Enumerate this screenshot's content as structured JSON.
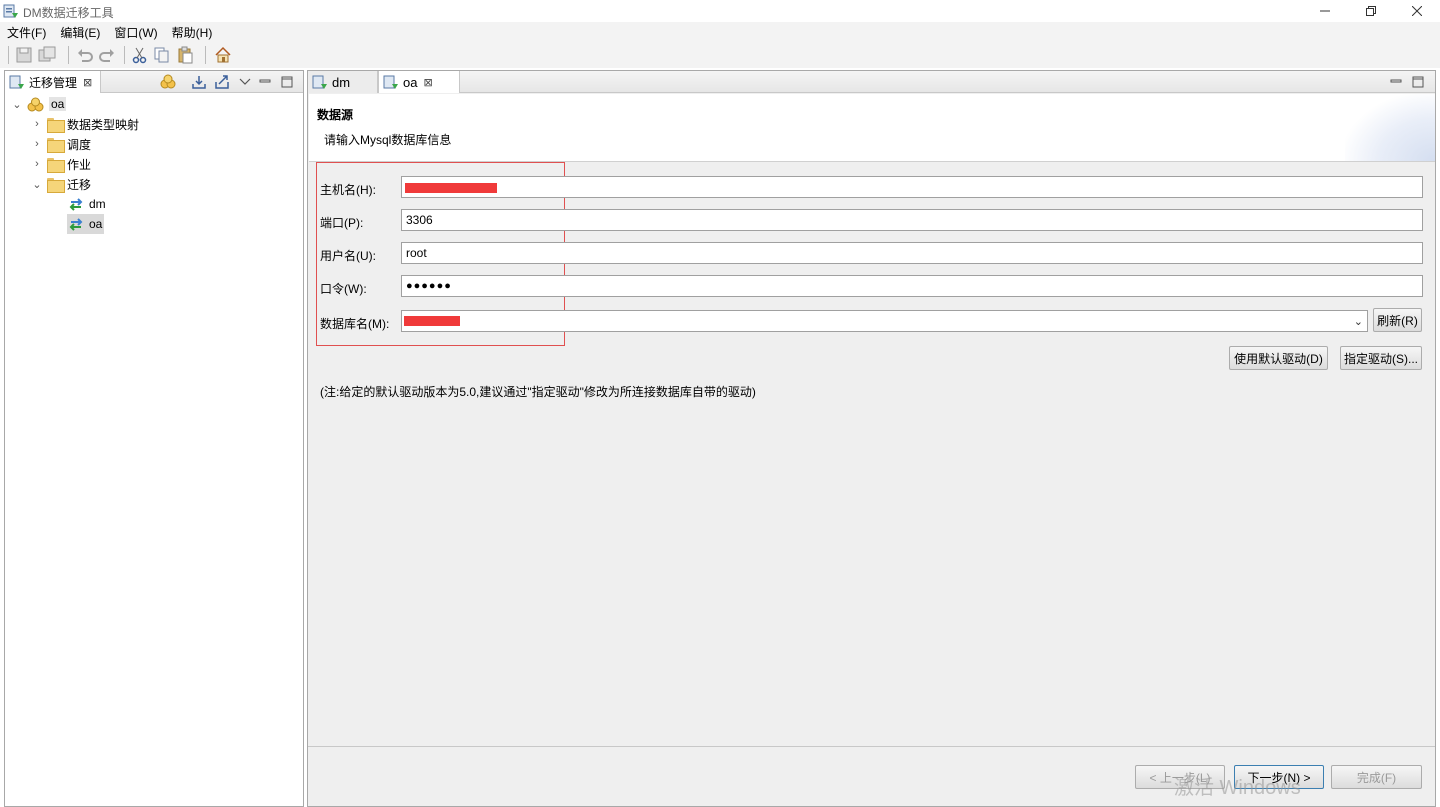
{
  "window": {
    "title": "DM数据迁移工具"
  },
  "menu": {
    "items": [
      "文件(F)",
      "编辑(E)",
      "窗口(W)",
      "帮助(H)"
    ]
  },
  "left_panel": {
    "tab_label": "迁移管理",
    "tree": {
      "root": "oa",
      "children": [
        "数据类型映射",
        "调度",
        "作业",
        "迁移"
      ],
      "migrations": [
        "dm",
        "oa"
      ]
    }
  },
  "editor": {
    "tabs": [
      "dm",
      "oa"
    ],
    "header": {
      "title": "数据源",
      "description": "请输入Mysql数据库信息"
    },
    "form": {
      "host_label": "主机名(H):",
      "port_label": "端口(P):",
      "port_value": "3306",
      "user_label": "用户名(U):",
      "user_value": "root",
      "password_label": "口令(W):",
      "password_value": "●●●●●●",
      "database_label": "数据库名(M):"
    },
    "buttons": {
      "refresh": "刷新(R)",
      "default_driver": "使用默认驱动(D)",
      "specify_driver": "指定驱动(S)...",
      "prev": "< 上一步(L)",
      "next": "下一步(N) >",
      "finish": "完成(F)"
    },
    "note": "(注:给定的默认驱动版本为5.0,建议通过\"指定驱动\"修改为所连接数据库自带的驱动)",
    "watermark": "激活 Windows"
  },
  "colors": {
    "redaction": "#f03a3a",
    "highlight_border": "#e05050",
    "default_button_border": "#3c7fb1"
  }
}
